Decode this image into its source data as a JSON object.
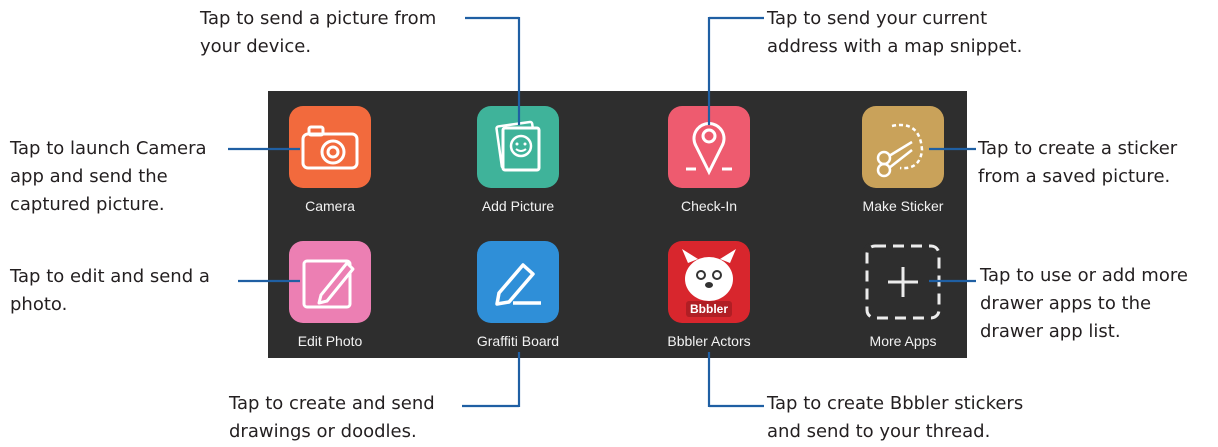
{
  "callouts": {
    "add_picture": "Tap to send a picture from\nyour device.",
    "check_in": "Tap to send your current\naddress with a map snippet.",
    "camera": "Tap to launch Camera\napp and send the\ncaptured picture.",
    "make_sticker": "Tap to create a sticker\nfrom a saved picture.",
    "edit_photo": "Tap to edit and send a\nphoto.",
    "more_apps": "Tap to use or add more\ndrawer apps to the\ndrawer app list.",
    "graffiti_board": "Tap to create and send\ndrawings or doodles.",
    "bbbler_actors": "Tap to create Bbbler stickers\nand send to your thread."
  },
  "apps": [
    {
      "label": "Camera",
      "icon": "camera-icon",
      "color": "#f26a3d"
    },
    {
      "label": "Add Picture",
      "icon": "picture-icon",
      "color": "#3fb39a"
    },
    {
      "label": "Check-In",
      "icon": "map-pin-icon",
      "color": "#ee5b6f"
    },
    {
      "label": "Make Sticker",
      "icon": "scissors-icon",
      "color": "#c9a25a"
    },
    {
      "label": "Edit Photo",
      "icon": "pencil-icon",
      "color": "#ec7fb3"
    },
    {
      "label": "Graffiti Board",
      "icon": "pen-icon",
      "color": "#2f8fd8"
    },
    {
      "label": "Bbbler Actors",
      "icon": "bbbler-icon",
      "color": "#d8262d",
      "badge": "Bbbler"
    },
    {
      "label": "More Apps",
      "icon": "plus-icon",
      "color": "#2e2e2e"
    }
  ],
  "colors": {
    "panel": "#2e2e2e",
    "leader": "#1f5fa3"
  }
}
